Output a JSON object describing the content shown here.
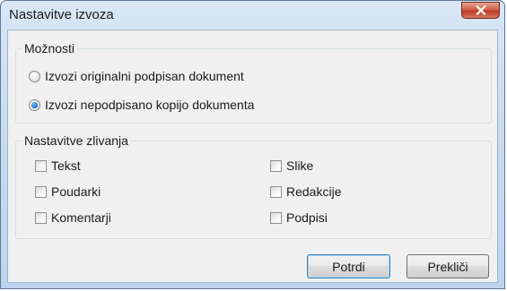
{
  "window": {
    "title": "Nastavitve izvoza"
  },
  "options_group": {
    "legend": "Možnosti",
    "radios": [
      {
        "label": "Izvozi originalni podpisan dokument",
        "checked": false
      },
      {
        "label": "Izvozi nepodpisano kopijo dokumenta",
        "checked": true
      }
    ]
  },
  "merge_group": {
    "legend": "Nastavitve zlivanja",
    "left": [
      {
        "label": "Tekst",
        "checked": false
      },
      {
        "label": "Poudarki",
        "checked": false
      },
      {
        "label": "Komentarji",
        "checked": false
      }
    ],
    "right": [
      {
        "label": "Slike",
        "checked": false
      },
      {
        "label": "Redakcije",
        "checked": false
      },
      {
        "label": "Podpisi",
        "checked": false
      }
    ]
  },
  "buttons": {
    "ok": "Potrdi",
    "cancel": "Prekliči"
  },
  "icons": {
    "close": "close-icon"
  },
  "colors": {
    "close_button": "#c7432b",
    "default_button_border": "#3c7fb1",
    "radio_checked": "#2a78d8"
  }
}
